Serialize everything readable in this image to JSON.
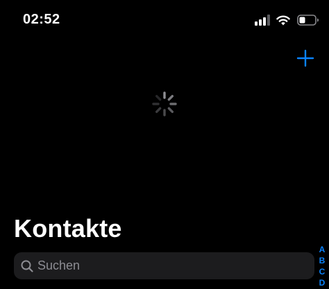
{
  "status_bar": {
    "time": "02:52",
    "icons": [
      "cellular-signal-icon",
      "wifi-icon",
      "battery-icon"
    ]
  },
  "toolbar": {
    "add_icon": "plus-icon"
  },
  "loading": {
    "icon": "activity-spinner-icon"
  },
  "header": {
    "title": "Kontakte"
  },
  "search": {
    "placeholder": "Suchen",
    "value": "",
    "icon": "magnifier-icon"
  },
  "index": {
    "letters": [
      "A",
      "B",
      "C",
      "D"
    ]
  },
  "colors": {
    "background": "#000000",
    "accent": "#0a84ff",
    "search_field": "#1c1c1e",
    "placeholder": "#8d8d93",
    "spinner": "#8e8e93"
  }
}
